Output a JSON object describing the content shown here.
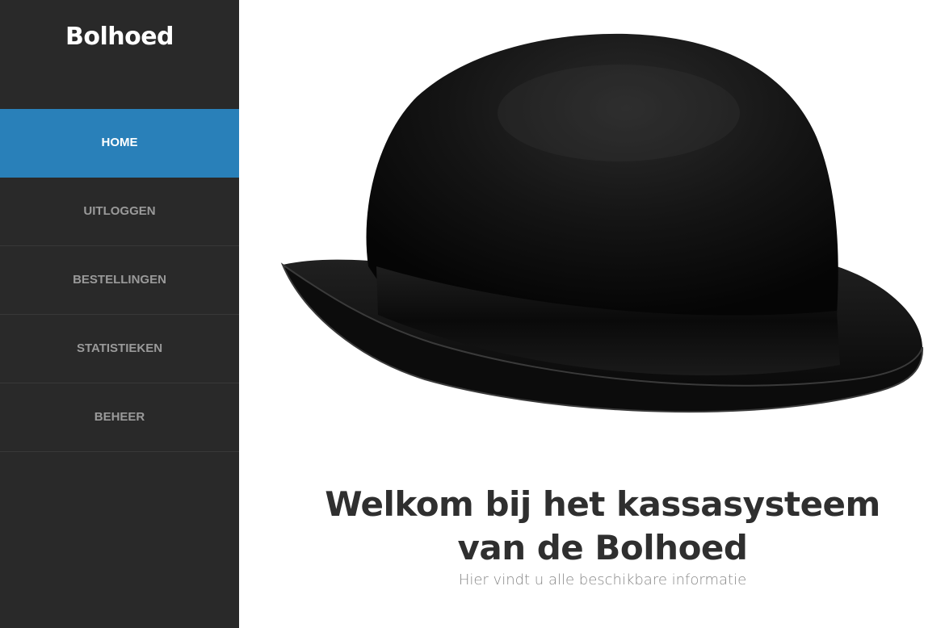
{
  "sidebar": {
    "brand": "Bolhoed",
    "items": [
      {
        "label": "HOME",
        "active": true
      },
      {
        "label": "UITLOGGEN",
        "active": false
      },
      {
        "label": "BESTELLINGEN",
        "active": false
      },
      {
        "label": "STATISTIEKEN",
        "active": false
      },
      {
        "label": "BEHEER",
        "active": false
      }
    ]
  },
  "main": {
    "hero_image": "bowler-hat-image",
    "heading": "Welkom bij het kassasysteem van de Bolhoed",
    "subheading": "Hier vindt u alle beschikbare informatie"
  },
  "colors": {
    "sidebar_bg": "#292929",
    "active_bg": "#2980b9",
    "nav_text": "#9a9a9a"
  }
}
